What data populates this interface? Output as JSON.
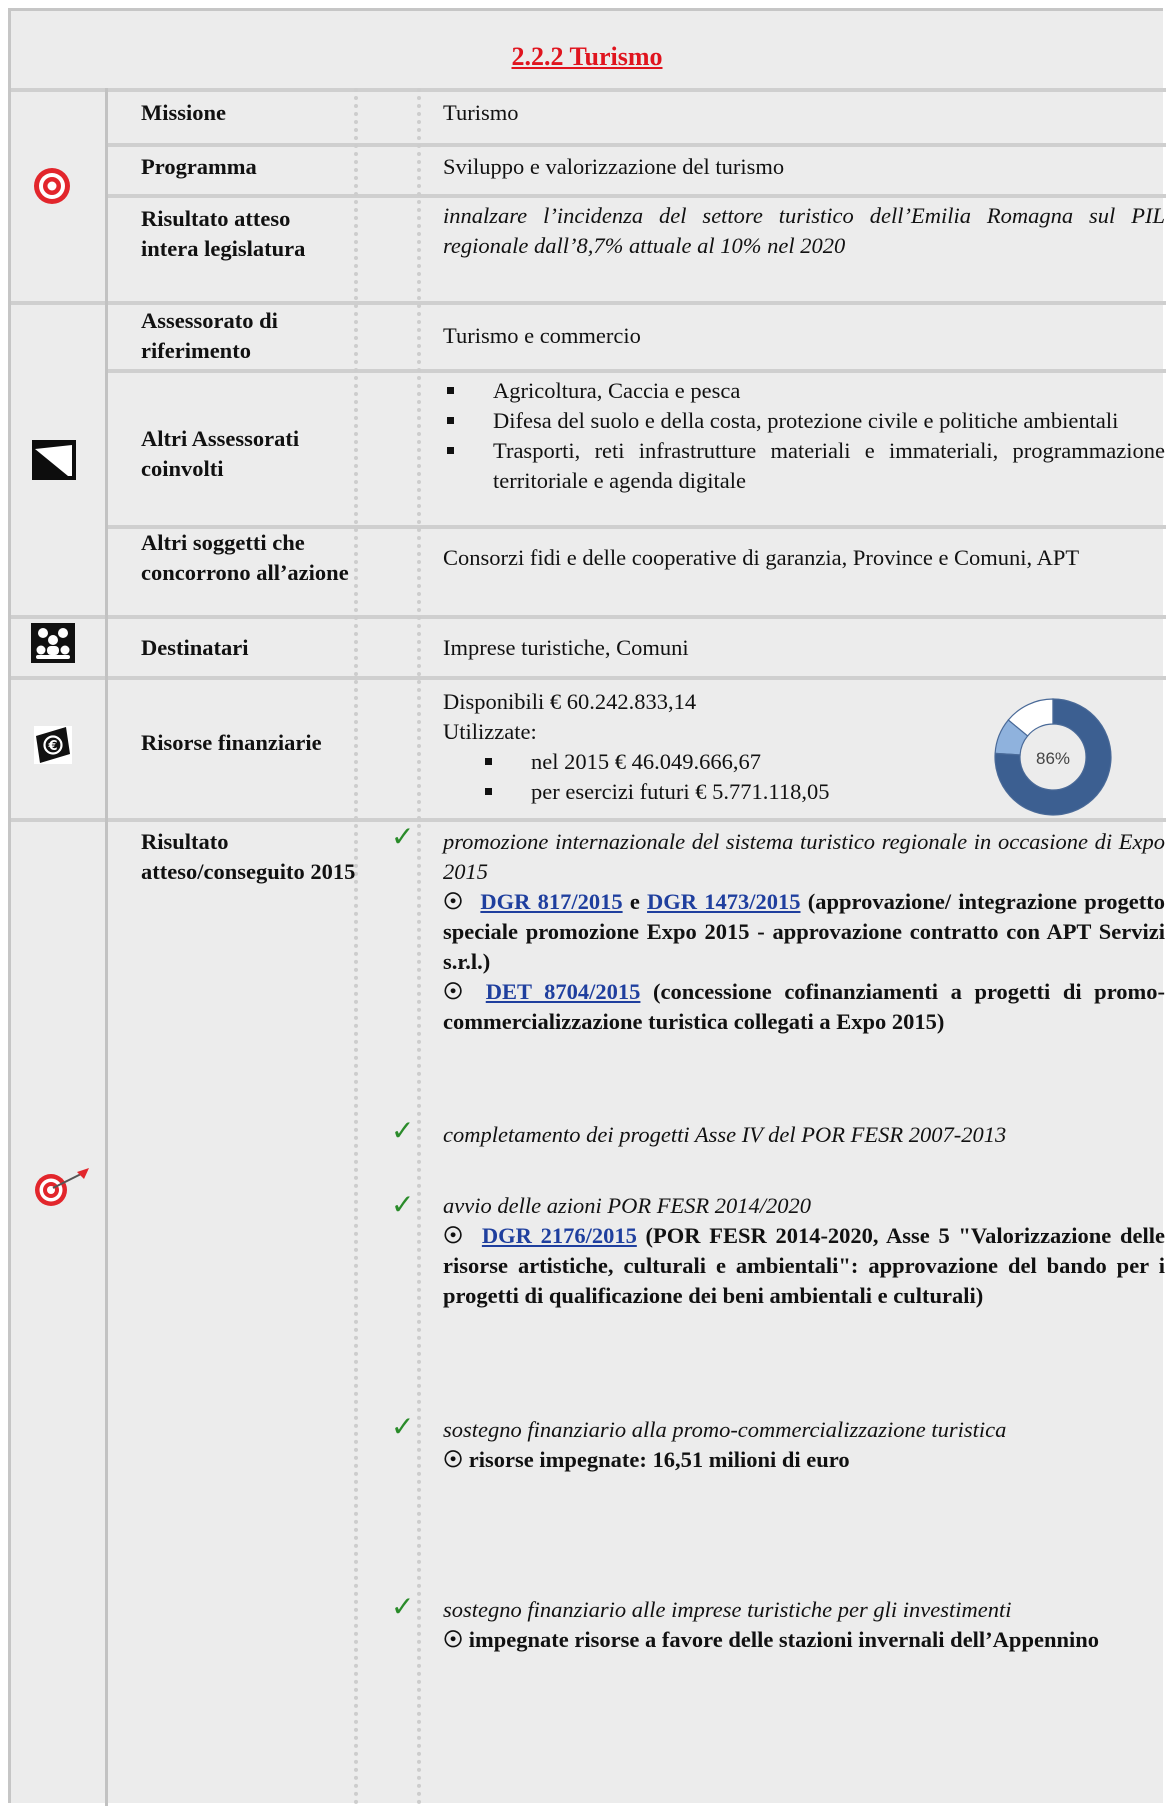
{
  "title": "2.2.2 Turismo",
  "rows": {
    "missione": {
      "label": "Missione",
      "value": "Turismo"
    },
    "programma": {
      "label": "Programma",
      "value": "Sviluppo e valorizzazione del turismo"
    },
    "risultato_legislatura": {
      "label": "Risultato atteso intera legislatura",
      "value": "innalzare l’incidenza del settore turistico dell’Emilia Romagna sul PIL regionale dall’8,7% attuale al 10% nel 2020"
    },
    "assessorato": {
      "label": "Assessorato di riferimento",
      "value": "Turismo e commercio"
    },
    "altri_assessorati": {
      "label": "Altri Assessorati coinvolti",
      "items": [
        "Agricoltura, Caccia e pesca",
        "Difesa del suolo e della costa, protezione civile e politiche ambientali",
        "Trasporti, reti infrastrutture materiali e immateriali, programmazione territoriale e agenda digitale"
      ]
    },
    "altri_soggetti": {
      "label": "Altri soggetti che concorrono all’azione",
      "value": "Consorzi fidi e delle cooperative di garanzia, Province e Comuni, APT"
    },
    "destinatari": {
      "label": "Destinatari",
      "value": "Imprese turistiche, Comuni"
    },
    "risorse": {
      "label": "Risorse finanziarie",
      "disponibili": "Disponibili € 60.242.833,14",
      "utilizzate": "Utilizzate:",
      "items": [
        "nel 2015 € 46.049.666,67",
        "per esercizi futuri € 5.771.118,05"
      ],
      "donut_label": "86%"
    },
    "risultato_2015": {
      "label": "Risultato atteso/conseguito 2015"
    }
  },
  "chart_data": {
    "type": "pie",
    "variant": "donut",
    "center_label": "86%",
    "slices": [
      {
        "value": 76,
        "color": "#3c5f91"
      },
      {
        "value": 10,
        "color": "#8fb2dd"
      },
      {
        "value": 14,
        "color": "#ffffff"
      }
    ]
  },
  "results": {
    "r1": {
      "title": "promozione internazionale del sistema turistico regionale in occasione di Expo 2015",
      "bullet": "☉",
      "link1": "DGR 817/2015",
      "mid": "e",
      "link2": "DGR 1473/2015",
      "text1": "(approvazione/ integrazione progetto speciale promozione Expo 2015 - approvazione contratto con APT Servizi s.r.l.)",
      "link3": "DET 8704/2015",
      "text2": "(concessione cofinanziamenti a progetti di promo-commercializzazione turistica collegati a Expo 2015)"
    },
    "r2": {
      "title": "completamento dei progetti Asse IV del POR FESR 2007-2013"
    },
    "r3": {
      "title": "avvio delle azioni POR FESR 2014/2020",
      "link": "DGR 2176/2015",
      "text": "(POR FESR 2014-2020, Asse 5 \"Valorizzazione delle risorse artistiche, culturali e ambientali\": approvazione del bando per i progetti di qualificazione dei beni ambientali e culturali)"
    },
    "r4": {
      "title": "sostegno finanziario alla promo-commercializzazione turistica",
      "text": "risorse impegnate: 16,51 milioni di euro"
    },
    "r5": {
      "title": "sostegno finanziario alle imprese turistiche per gli investimenti",
      "text": "impegnate risorse a favore delle stazioni invernali dell’Appennino"
    }
  },
  "check_symbol": "✓"
}
